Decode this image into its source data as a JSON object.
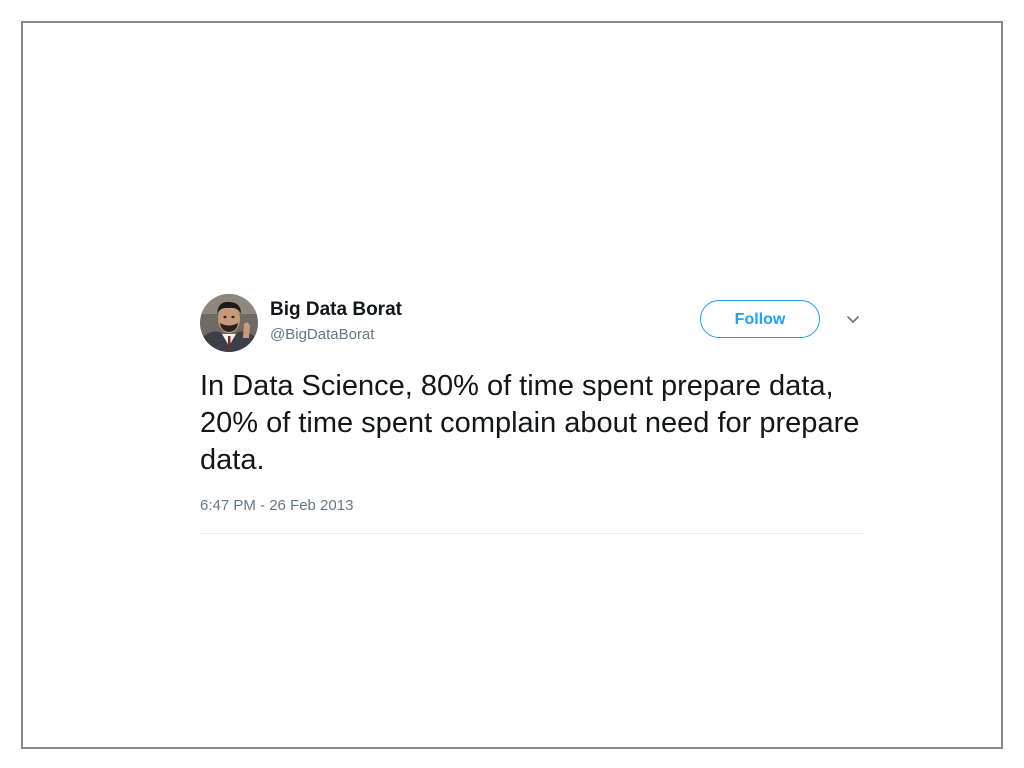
{
  "tweet": {
    "author": {
      "display_name": "Big Data Borat",
      "handle": "@BigDataBorat"
    },
    "follow_label": "Follow",
    "text": "In Data Science, 80% of time spent prepare data, 20% of time spent complain about need for prepare data.",
    "timestamp": "6:47 PM - 26 Feb 2013"
  },
  "icons": {
    "avatar": "profile-photo",
    "caret": "chevron-down-icon"
  },
  "colors": {
    "accent": "#1da1f2",
    "text_primary": "#14171a",
    "text_secondary": "#657786",
    "frame_border": "#8a8a86",
    "divider": "#e6ecf0"
  }
}
